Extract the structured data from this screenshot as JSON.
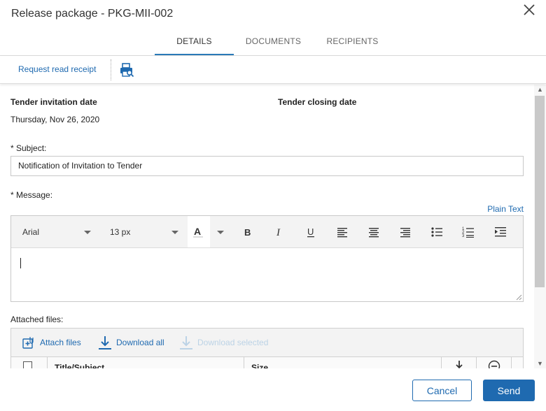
{
  "dialog": {
    "title": "Release package - PKG-MII-002",
    "tabs": [
      {
        "label": "DETAILS",
        "active": true
      },
      {
        "label": "DOCUMENTS",
        "active": false
      },
      {
        "label": "RECIPIENTS",
        "active": false
      }
    ]
  },
  "toolbar": {
    "request_read_receipt": "Request read receipt",
    "print_icon": "print-preview-icon"
  },
  "form": {
    "tender_invitation_date_label": "Tender invitation date",
    "tender_invitation_date_value": "Thursday, Nov 26, 2020",
    "tender_closing_date_label": "Tender closing date",
    "subject_label": "* Subject:",
    "subject_value": "Notification of Invitation to Tender",
    "message_label": "* Message:",
    "plain_text_link": "Plain Text",
    "editor": {
      "font_family": "Arial",
      "font_size": "13 px",
      "tools": [
        "font-color",
        "bold",
        "italic",
        "underline",
        "align-left",
        "align-center",
        "align-right",
        "bullet-list",
        "numbered-list",
        "indent"
      ]
    },
    "attached_files_label": "Attached files:"
  },
  "files": {
    "attach_label": "Attach files",
    "download_all_label": "Download all",
    "download_selected_label": "Download selected",
    "columns": [
      "Title/Subject",
      "Size"
    ]
  },
  "footer": {
    "cancel_label": "Cancel",
    "send_label": "Send"
  },
  "colors": {
    "accent": "#1f6ab0",
    "tab_underline": "#2a7ab8"
  }
}
